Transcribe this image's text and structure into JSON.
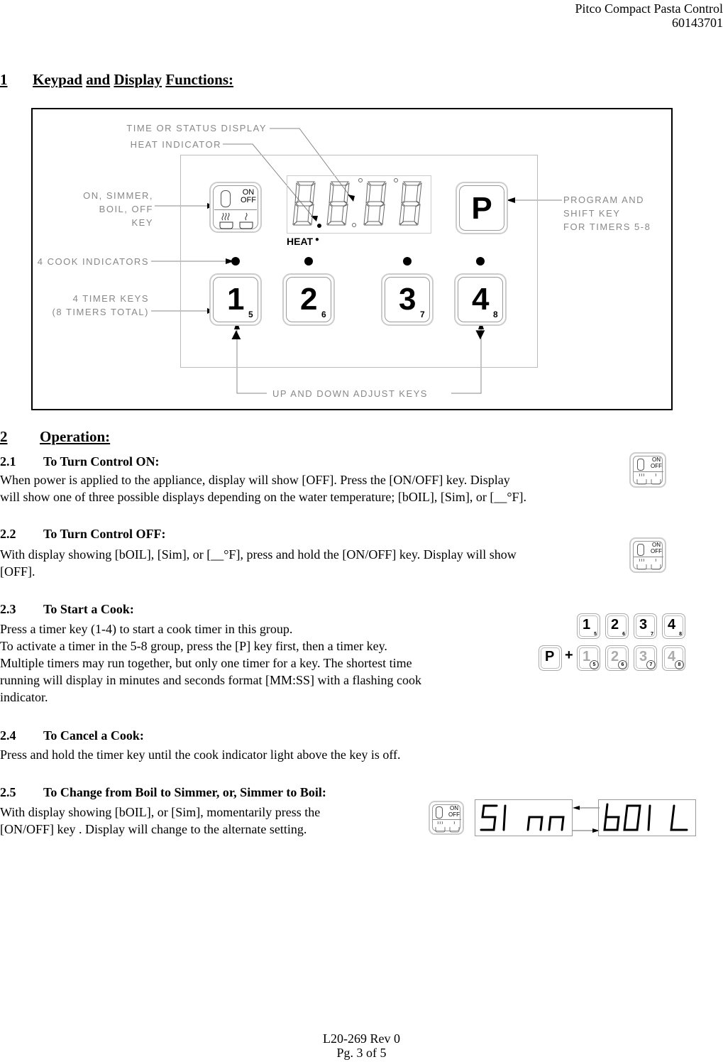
{
  "header": {
    "title": "Pitco Compact Pasta Control",
    "part_number": "60143701"
  },
  "section1": {
    "number": "1",
    "title_words": [
      "Keypad",
      "and",
      "Display",
      "Functions:"
    ]
  },
  "diagram": {
    "callouts": {
      "time_status_display": "TIME OR STATUS DISPLAY",
      "heat_indicator": "HEAT INDICATOR",
      "on_off_key": [
        "ON, SIMMER,",
        "BOIL, OFF",
        "KEY"
      ],
      "cook_indicators": "4 COOK INDICATORS",
      "timer_keys": [
        "4 TIMER KEYS",
        "(8 TIMERS TOTAL)"
      ],
      "program_key": [
        "PROGRAM AND",
        "SHIFT KEY",
        "FOR TIMERS 5-8"
      ],
      "adjust_keys": "UP AND DOWN ADJUST KEYS"
    },
    "on_off_key": {
      "line1": "ON",
      "line2": "OFF"
    },
    "heat_label": "HEAT",
    "program_key_label": "P",
    "timer_keys": [
      {
        "main": "1",
        "shift": "5"
      },
      {
        "main": "2",
        "shift": "6"
      },
      {
        "main": "3",
        "shift": "7"
      },
      {
        "main": "4",
        "shift": "8"
      }
    ],
    "up_arrow": "▲",
    "down_arrow": "▼"
  },
  "section2": {
    "number": "2",
    "title": "Operation:",
    "subsections": [
      {
        "number": "2.1",
        "title": "To Turn Control ON:",
        "lines": [
          "When power is applied to the appliance, display will show [OFF].  Press the [ON/OFF] key.  Display",
          "will show one of three possible displays depending on the water temperature;  [bOIL], [Sim], or [__°F]."
        ]
      },
      {
        "number": "2.2",
        "title": "To Turn Control OFF:",
        "lines": [
          "With display showing [bOIL], [Sim], or [__°F], press and hold the [ON/OFF] key.  Display will show",
          "[OFF]."
        ]
      },
      {
        "number": "2.3",
        "title": "To Start a Cook:",
        "lines": [
          "Press a timer key (1-4) to start a cook timer in this group.",
          "To activate a timer in the 5-8 group, press the [P] key first, then a timer key.",
          "Multiple timers may run together, but only one timer for a key.  The shortest time",
          "running will display in minutes and seconds format [MM:SS] with a flashing cook",
          "indicator."
        ]
      },
      {
        "number": "2.4",
        "title": "To Cancel a Cook:",
        "lines": [
          "Press and hold the timer key until the cook indicator light above the key is off."
        ]
      },
      {
        "number": "2.5",
        "title": "To Change from Boil to Simmer, or, Simmer to Boil:",
        "lines": [
          "With display showing [bOIL], or [Sim], momentarily press the",
          "[ON/OFF] key .  Display will change to the alternate setting."
        ]
      }
    ]
  },
  "illustrations": {
    "small_on_off": {
      "line1": "ON",
      "line2": "OFF"
    },
    "plus_sign": "+",
    "program_key_label": "P",
    "display_sim": "SI nn",
    "display_boil": "bOI L"
  },
  "footer": {
    "doc_id": "L20-269 Rev 0",
    "page": "Pg. 3 of 5"
  }
}
